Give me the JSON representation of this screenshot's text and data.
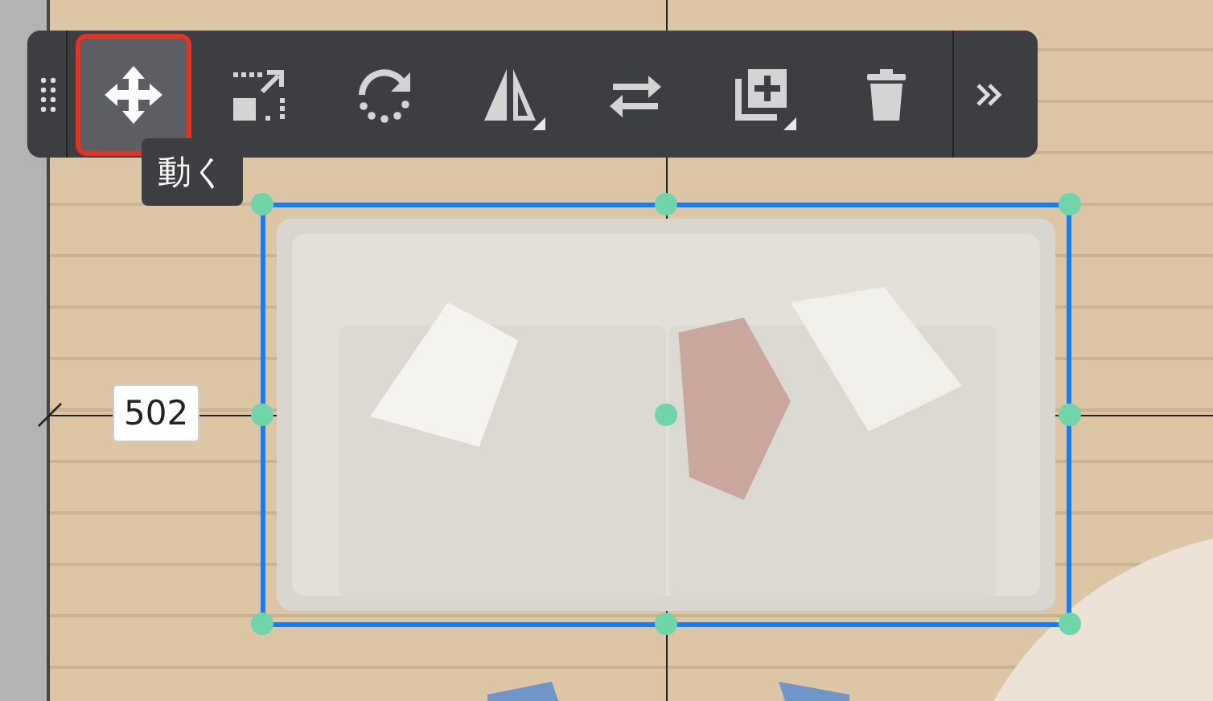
{
  "toolbar": {
    "tools": [
      {
        "kind": "move",
        "selected": true,
        "submenu": false
      },
      {
        "kind": "scale",
        "selected": false,
        "submenu": false
      },
      {
        "kind": "rotate",
        "selected": false,
        "submenu": false
      },
      {
        "kind": "mirror",
        "selected": false,
        "submenu": true
      },
      {
        "kind": "swap",
        "selected": false,
        "submenu": false
      },
      {
        "kind": "duplicate",
        "selected": false,
        "submenu": true
      },
      {
        "kind": "delete",
        "selected": false,
        "submenu": false
      }
    ],
    "tooltip": "動く"
  },
  "dimension": {
    "label": "502"
  }
}
